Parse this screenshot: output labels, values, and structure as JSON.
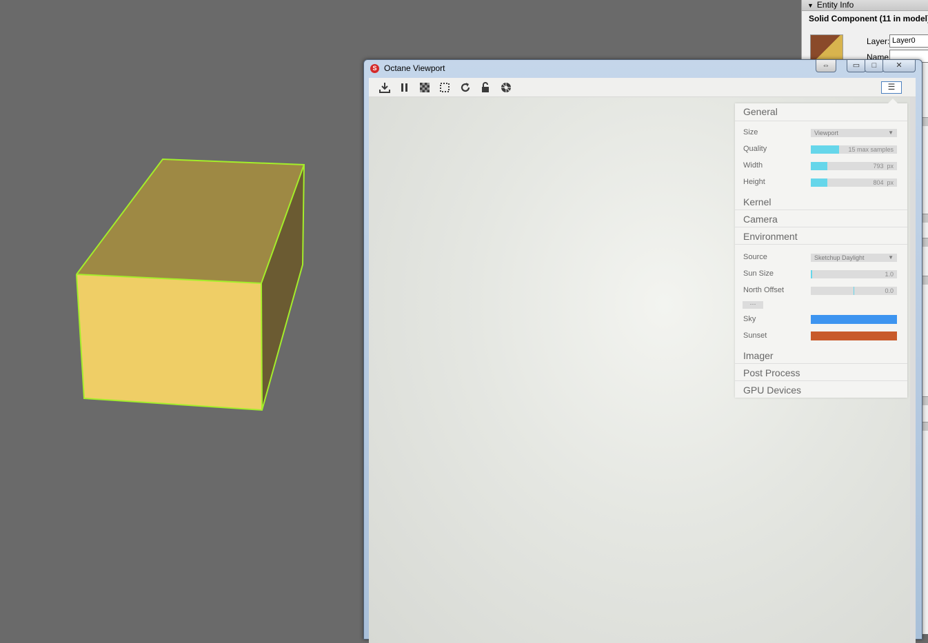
{
  "entity_info": {
    "header": "Entity Info",
    "subtitle": "Solid Component (11 in model)",
    "layer_label": "Layer:",
    "layer_value": "Layer0",
    "name_label": "Name:",
    "name_value": ""
  },
  "window": {
    "title": "Octane Viewport",
    "resize_icon": "⇔",
    "minimize_icon": "▭",
    "maximize_icon": "□",
    "close_icon": "✕"
  },
  "toolbar": {
    "icons": [
      "download-icon",
      "pause-icon",
      "checkerboard-icon",
      "region-select-icon",
      "refresh-icon",
      "unlock-icon",
      "aperture-icon"
    ],
    "menu_glyph": "☰"
  },
  "settings": {
    "general": {
      "title": "General",
      "size_label": "Size",
      "size_value": "Viewport",
      "quality_label": "Quality",
      "quality_value": "15 max samples",
      "quality_level": 0.33,
      "width_label": "Width",
      "width_value": "793",
      "width_unit": "px",
      "width_level": 0.19,
      "height_label": "Height",
      "height_value": "804",
      "height_unit": "px",
      "height_level": 0.19
    },
    "kernel_title": "Kernel",
    "camera_title": "Camera",
    "environment": {
      "title": "Environment",
      "source_label": "Source",
      "source_value": "Sketchup Daylight",
      "sun_size_label": "Sun Size",
      "sun_size_value": "1.0",
      "north_offset_label": "North Offset",
      "north_offset_value": "0.0",
      "more_label": "···",
      "sky_label": "Sky",
      "sky_color": "#3d94f0",
      "sunset_label": "Sunset",
      "sunset_color": "#c85a2a"
    },
    "imager_title": "Imager",
    "post_process_title": "Post Process",
    "gpu_devices_title": "GPU Devices"
  },
  "colors": {
    "accent_fill": "#66d6ea",
    "selection_edge": "#a4ee2a",
    "box_front": "#efce66",
    "box_top": "#9e8944",
    "box_side": "#6b5b32"
  }
}
